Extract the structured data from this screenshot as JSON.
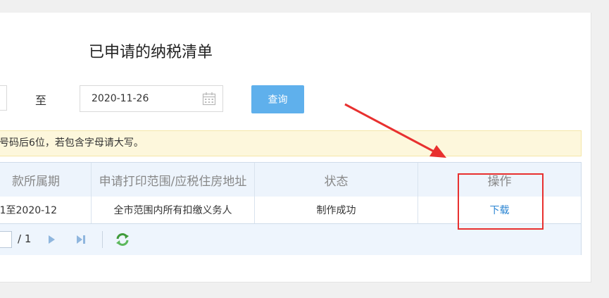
{
  "page": {
    "title": "已申请的纳税清单"
  },
  "search": {
    "to_label": "至",
    "end_date": "2020-11-26",
    "query_label": "查询"
  },
  "notice": {
    "text": "号码后6位，若包含字母请大写。"
  },
  "table": {
    "headers": [
      "款所属期",
      "申请打印范围/应税住房地址",
      "状态",
      "操作"
    ],
    "rows": [
      {
        "period": "1至2020-12",
        "scope": "全市范围内所有扣缴义务人",
        "status": "制作成功",
        "action": "下载"
      }
    ]
  },
  "pager": {
    "total": "/ 1"
  },
  "colors": {
    "accent": "#5fb0ec",
    "link": "#2a84d2",
    "annotation": "#e8302f",
    "notice_bg": "#fdf7dc",
    "header_bg": "#edf4fc"
  },
  "icons": [
    "calendar-icon",
    "next-page-icon",
    "last-page-icon",
    "refresh-icon"
  ]
}
